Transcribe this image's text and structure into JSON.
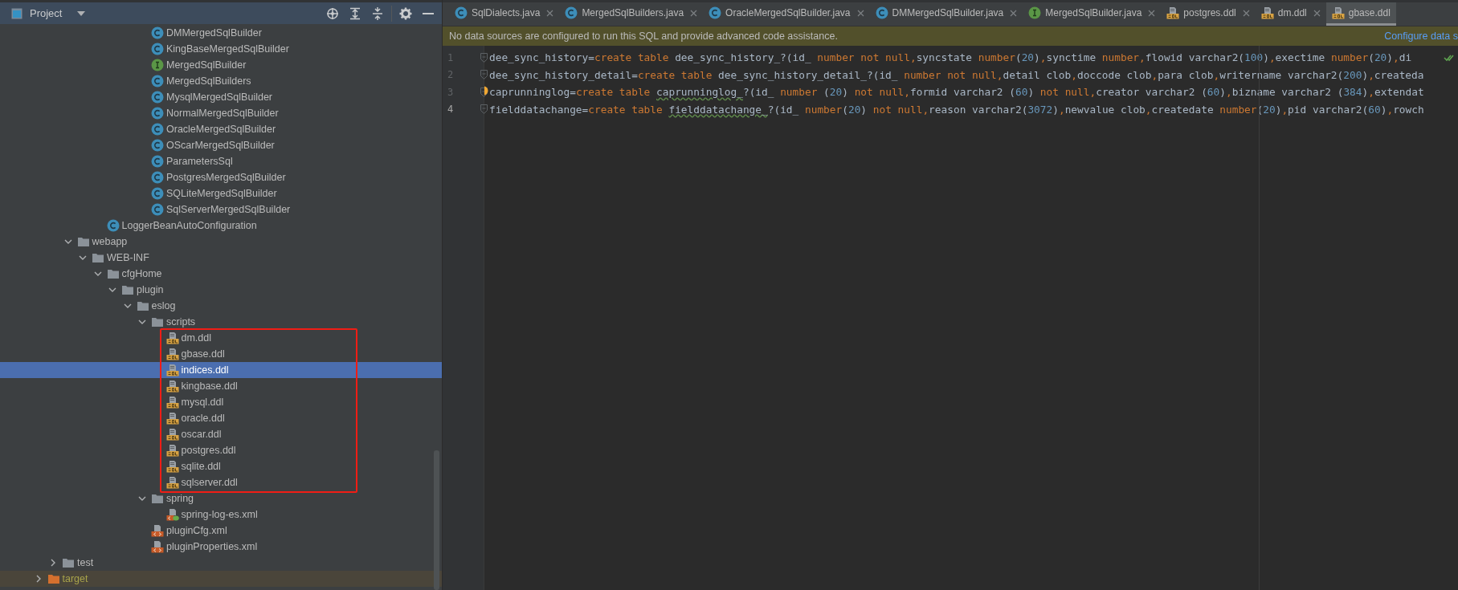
{
  "project_panel": {
    "title": "Project"
  },
  "tree": [
    {
      "children": [
        {
          "children": [
            {
              "children": [
                {
                  "children": [
                    {
                      "children": [
                        {
                          "children": [
                            {
                              "children": [
                                {
                                  "label": "DMMergedSqlBuilder",
                                  "kind": "class",
                                  "selected": false
                                },
                                {
                                  "label": "KingBaseMergedSqlBuilder",
                                  "kind": "class",
                                  "selected": false
                                },
                                {
                                  "label": "MergedSqlBuilder",
                                  "kind": "interface",
                                  "selected": false
                                },
                                {
                                  "label": "MergedSqlBuilders",
                                  "kind": "class",
                                  "selected": false
                                },
                                {
                                  "label": "MysqlMergedSqlBuilder",
                                  "kind": "class",
                                  "selected": false
                                },
                                {
                                  "label": "NormalMergedSqlBuilder",
                                  "kind": "class",
                                  "selected": false
                                },
                                {
                                  "label": "OracleMergedSqlBuilder",
                                  "kind": "class",
                                  "selected": false
                                },
                                {
                                  "label": "OScarMergedSqlBuilder",
                                  "kind": "class",
                                  "selected": false
                                },
                                {
                                  "label": "ParametersSql",
                                  "kind": "class",
                                  "selected": false
                                },
                                {
                                  "label": "PostgresMergedSqlBuilder",
                                  "kind": "class",
                                  "selected": false
                                },
                                {
                                  "label": "SQLiteMergedSqlBuilder",
                                  "kind": "class",
                                  "selected": false
                                },
                                {
                                  "label": "SqlServerMergedSqlBuilder",
                                  "kind": "class",
                                  "selected": false
                                }
                              ]
                            }
                          ]
                        }
                      ]
                    },
                    {
                      "label": "LoggerBeanAutoConfiguration",
                      "kind": "class",
                      "selected": false
                    }
                  ]
                }
              ]
            },
            {
              "label": "webapp",
              "kind": "folder",
              "expanded": true,
              "selected": false,
              "children": [
                {
                  "label": "WEB-INF",
                  "kind": "folder",
                  "expanded": true,
                  "selected": false,
                  "children": [
                    {
                      "label": "cfgHome",
                      "kind": "folder",
                      "expanded": true,
                      "selected": false,
                      "children": [
                        {
                          "label": "plugin",
                          "kind": "folder",
                          "expanded": true,
                          "selected": false,
                          "children": [
                            {
                              "label": "eslog",
                              "kind": "folder",
                              "expanded": true,
                              "selected": false,
                              "children": [
                                {
                                  "label": "scripts",
                                  "kind": "folder",
                                  "expanded": true,
                                  "selected": false,
                                  "framed": true,
                                  "children": [
                                    {
                                      "label": "dm.ddl",
                                      "kind": "sql",
                                      "selected": false
                                    },
                                    {
                                      "label": "gbase.ddl",
                                      "kind": "sql",
                                      "selected": false
                                    },
                                    {
                                      "label": "indices.ddl",
                                      "kind": "sql",
                                      "selected": true
                                    },
                                    {
                                      "label": "kingbase.ddl",
                                      "kind": "sql",
                                      "selected": false
                                    },
                                    {
                                      "label": "mysql.ddl",
                                      "kind": "sql",
                                      "selected": false
                                    },
                                    {
                                      "label": "oracle.ddl",
                                      "kind": "sql",
                                      "selected": false
                                    },
                                    {
                                      "label": "oscar.ddl",
                                      "kind": "sql",
                                      "selected": false
                                    },
                                    {
                                      "label": "postgres.ddl",
                                      "kind": "sql",
                                      "selected": false
                                    },
                                    {
                                      "label": "sqlite.ddl",
                                      "kind": "sql",
                                      "selected": false
                                    },
                                    {
                                      "label": "sqlserver.ddl",
                                      "kind": "sql",
                                      "selected": false
                                    }
                                  ]
                                },
                                {
                                  "label": "spring",
                                  "kind": "folder",
                                  "expanded": true,
                                  "selected": false,
                                  "children": [
                                    {
                                      "label": "spring-log-es.xml",
                                      "kind": "spring",
                                      "selected": false
                                    }
                                  ]
                                },
                                {
                                  "label": "pluginCfg.xml",
                                  "kind": "xml",
                                  "selected": false
                                },
                                {
                                  "label": "pluginProperties.xml",
                                  "kind": "xml",
                                  "selected": false
                                }
                              ]
                            }
                          ]
                        }
                      ]
                    }
                  ]
                }
              ]
            }
          ]
        },
        {
          "label": "test",
          "kind": "folder",
          "expanded": false,
          "selected": false
        }
      ]
    },
    {
      "label": "target",
      "kind": "excluded",
      "expanded": false,
      "selected": false
    }
  ],
  "tabs": [
    {
      "label": "SqlDialects.java",
      "kind": "class",
      "selected": false,
      "closable": true
    },
    {
      "label": "MergedSqlBuilders.java",
      "kind": "class",
      "selected": false,
      "closable": true
    },
    {
      "label": "OracleMergedSqlBuilder.java",
      "kind": "class",
      "selected": false,
      "closable": true
    },
    {
      "label": "DMMergedSqlBuilder.java",
      "kind": "class",
      "selected": false,
      "closable": true
    },
    {
      "label": "MergedSqlBuilder.java",
      "kind": "interface",
      "selected": false,
      "closable": true
    },
    {
      "label": "postgres.ddl",
      "kind": "sql",
      "selected": false,
      "closable": true
    },
    {
      "label": "dm.ddl",
      "kind": "sql",
      "selected": false,
      "closable": true
    },
    {
      "label": "gbase.ddl",
      "kind": "sql",
      "selected": true,
      "closable": false
    }
  ],
  "notification": {
    "message": "No data sources are configured to run this SQL and provide advanced code assistance.",
    "link": "Configure data s"
  },
  "code_lines": [
    {
      "number": "1",
      "current": false,
      "bulb": false,
      "tokens": [
        {
          "kind": "plain",
          "text": "dee_sync_history="
        },
        {
          "kind": "keyword",
          "text": "create table"
        },
        {
          "kind": "plain",
          "text": " dee_sync_history_?(id_ "
        },
        {
          "kind": "keyword",
          "text": "number not null,"
        },
        {
          "kind": "plain",
          "text": "syncstate "
        },
        {
          "kind": "keyword",
          "text": "number"
        },
        {
          "kind": "plain",
          "text": "("
        },
        {
          "kind": "number",
          "text": "20"
        },
        {
          "kind": "plain",
          "text": ")"
        },
        {
          "kind": "keyword",
          "text": ","
        },
        {
          "kind": "plain",
          "text": "synctime "
        },
        {
          "kind": "keyword",
          "text": "number,"
        },
        {
          "kind": "plain",
          "text": "flowid varchar2("
        },
        {
          "kind": "number",
          "text": "100"
        },
        {
          "kind": "plain",
          "text": ")"
        },
        {
          "kind": "keyword",
          "text": ","
        },
        {
          "kind": "plain",
          "text": "exectime "
        },
        {
          "kind": "keyword",
          "text": "number"
        },
        {
          "kind": "plain",
          "text": "("
        },
        {
          "kind": "number",
          "text": "20"
        },
        {
          "kind": "plain",
          "text": ")"
        },
        {
          "kind": "keyword",
          "text": ","
        },
        {
          "kind": "plain",
          "text": "di"
        }
      ]
    },
    {
      "number": "2",
      "current": false,
      "bulb": false,
      "tokens": [
        {
          "kind": "plain",
          "text": "dee_sync_history_detail="
        },
        {
          "kind": "keyword",
          "text": "create table"
        },
        {
          "kind": "plain",
          "text": " dee_sync_history_detail_?(id_ "
        },
        {
          "kind": "keyword",
          "text": "number not null,"
        },
        {
          "kind": "plain",
          "text": "detail clob"
        },
        {
          "kind": "keyword",
          "text": ","
        },
        {
          "kind": "plain",
          "text": "doccode clob"
        },
        {
          "kind": "keyword",
          "text": ","
        },
        {
          "kind": "plain",
          "text": "para clob"
        },
        {
          "kind": "keyword",
          "text": ","
        },
        {
          "kind": "plain",
          "text": "writername varchar2("
        },
        {
          "kind": "number",
          "text": "200"
        },
        {
          "kind": "plain",
          "text": ")"
        },
        {
          "kind": "keyword",
          "text": ","
        },
        {
          "kind": "plain",
          "text": "createda"
        }
      ]
    },
    {
      "number": "3",
      "current": false,
      "bulb": true,
      "tokens": [
        {
          "kind": "plain",
          "text": "caprunninglog="
        },
        {
          "kind": "keyword",
          "text": "create table "
        },
        {
          "kind": "typo",
          "text": "caprunninglog_"
        },
        {
          "kind": "plain",
          "text": "?(id_ "
        },
        {
          "kind": "keyword",
          "text": "number"
        },
        {
          "kind": "plain",
          "text": " ("
        },
        {
          "kind": "number",
          "text": "20"
        },
        {
          "kind": "plain",
          "text": ") "
        },
        {
          "kind": "keyword",
          "text": "not null,"
        },
        {
          "kind": "plain",
          "text": "formid varchar2 ("
        },
        {
          "kind": "number",
          "text": "60"
        },
        {
          "kind": "plain",
          "text": ") "
        },
        {
          "kind": "keyword",
          "text": "not null,"
        },
        {
          "kind": "plain",
          "text": "creator varchar2 ("
        },
        {
          "kind": "number",
          "text": "60"
        },
        {
          "kind": "plain",
          "text": ")"
        },
        {
          "kind": "keyword",
          "text": ","
        },
        {
          "kind": "plain",
          "text": "bizname varchar2 ("
        },
        {
          "kind": "number",
          "text": "384"
        },
        {
          "kind": "plain",
          "text": ")"
        },
        {
          "kind": "keyword",
          "text": ","
        },
        {
          "kind": "plain",
          "text": "extendat"
        }
      ]
    },
    {
      "number": "4",
      "current": true,
      "bulb": false,
      "tokens": [
        {
          "kind": "plain",
          "text": "fielddatachange="
        },
        {
          "kind": "keyword",
          "text": "create table "
        },
        {
          "kind": "typo",
          "text": "fielddatachange_"
        },
        {
          "kind": "plain",
          "text": "?(id_ "
        },
        {
          "kind": "keyword",
          "text": "number"
        },
        {
          "kind": "plain",
          "text": "("
        },
        {
          "kind": "number",
          "text": "20"
        },
        {
          "kind": "plain",
          "text": ") "
        },
        {
          "kind": "keyword",
          "text": "not null,"
        },
        {
          "kind": "plain",
          "text": "reason varchar2("
        },
        {
          "kind": "number",
          "text": "3072"
        },
        {
          "kind": "plain",
          "text": ")"
        },
        {
          "kind": "keyword",
          "text": ","
        },
        {
          "kind": "plain",
          "text": "newvalue clob"
        },
        {
          "kind": "keyword",
          "text": ","
        },
        {
          "kind": "plain",
          "text": "createdate "
        },
        {
          "kind": "keyword",
          "text": "number"
        },
        {
          "kind": "plain",
          "text": "("
        },
        {
          "kind": "number",
          "text": "20"
        },
        {
          "kind": "plain",
          "text": ")"
        },
        {
          "kind": "keyword",
          "text": ","
        },
        {
          "kind": "plain",
          "text": "pid varchar2("
        },
        {
          "kind": "number",
          "text": "60"
        },
        {
          "kind": "plain",
          "text": ")"
        },
        {
          "kind": "keyword",
          "text": ","
        },
        {
          "kind": "plain",
          "text": "rowch"
        }
      ]
    }
  ]
}
